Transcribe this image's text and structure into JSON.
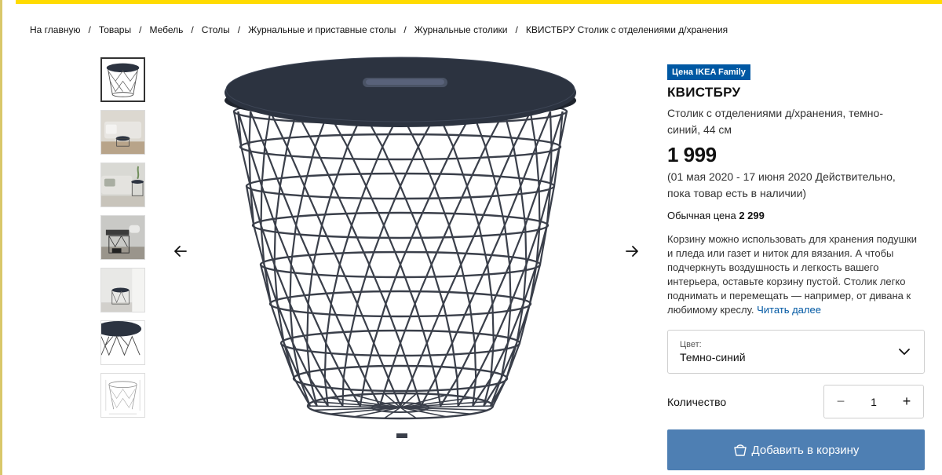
{
  "breadcrumb": [
    {
      "label": "На главную"
    },
    {
      "label": "Товары"
    },
    {
      "label": "Мебель"
    },
    {
      "label": "Столы"
    },
    {
      "label": "Журнальные и приставные столы"
    },
    {
      "label": "Журнальные столики"
    },
    {
      "label": "КВИСТБРУ Столик с отделениями д/хранения"
    }
  ],
  "breadcrumb_separator": "/",
  "gallery": {
    "thumbnail_count": 7,
    "active_index": 0,
    "prev_icon": "arrow-left-icon",
    "next_icon": "arrow-right-icon"
  },
  "product": {
    "badge": "Цена IKEA Family",
    "name": "КВИСТБРУ",
    "description": "Столик с отделениями д/хранения, темно-синий, 44 см",
    "price": "1 999",
    "currency_glyph": "",
    "validity": "(01 мая 2020 - 17 июня 2020 Действительно, пока товар есть в наличии)",
    "regular_price_label": "Обычная цена",
    "regular_price": "2 299",
    "long_description": "Корзину можно использовать для хранения подушки и пледа или газет и ниток для вязания. А чтобы подчеркнуть воздушность и легкость вашего интерьера, оставьте корзину пустой. Столик легко поднимать и перемещать — например, от дивана к любимому креслу.",
    "read_more": "Читать далее"
  },
  "color_select": {
    "label": "Цвет:",
    "value": "Темно-синий"
  },
  "quantity": {
    "label": "Количество",
    "value": "1",
    "minus": "−",
    "plus": "+"
  },
  "add_to_cart": {
    "label": "Добавить в корзину",
    "icon": "shopping-bag-icon"
  },
  "colors": {
    "accent_yellow": "#ffdb00",
    "family_blue": "#0058a3",
    "cart_button": "#4e7fb3",
    "table_top": "#2c3340"
  }
}
